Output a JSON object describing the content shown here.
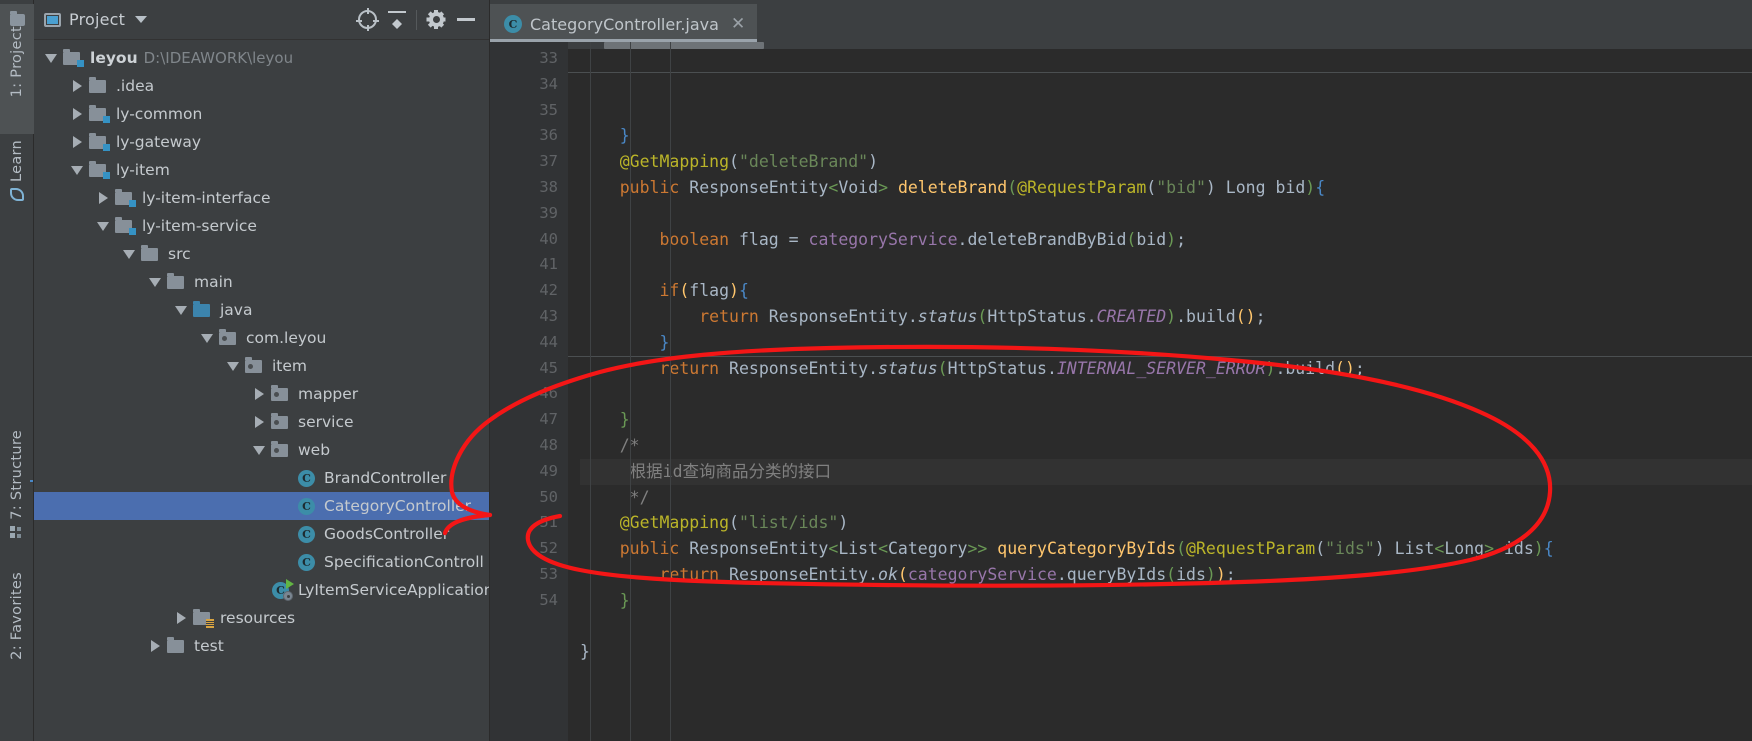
{
  "window": {
    "tool_tabs_left": [
      {
        "label": "1: Project",
        "icon": "project-folder-icon",
        "active": true
      },
      {
        "label": "Learn",
        "icon": "learn-icon",
        "active": false
      },
      {
        "label": "7: Structure",
        "icon": "structure-icon",
        "active": false
      },
      {
        "label": "2: Favorites",
        "icon": "favorites-icon",
        "active": false
      }
    ]
  },
  "project_panel": {
    "title": "Project",
    "dropdown_icon": "chevron-down-icon",
    "toolbar": [
      {
        "name": "locate-icon",
        "label": "Select Opened File"
      },
      {
        "name": "collapse-all-icon",
        "label": "Collapse All"
      },
      {
        "name": "gear-icon",
        "label": "Settings"
      },
      {
        "name": "minimize-icon",
        "label": "Hide"
      }
    ],
    "tree": [
      {
        "label": "leyou",
        "path": "D:\\IDEAWORK\\leyou",
        "depth": 0,
        "twisty": "down",
        "icon": "module-folder-icon",
        "bold": true,
        "selected": false
      },
      {
        "label": ".idea",
        "path": "",
        "depth": 1,
        "twisty": "right",
        "icon": "folder-icon",
        "bold": false,
        "selected": false
      },
      {
        "label": "ly-common",
        "path": "",
        "depth": 1,
        "twisty": "right",
        "icon": "module-folder-icon",
        "bold": false,
        "selected": false
      },
      {
        "label": "ly-gateway",
        "path": "",
        "depth": 1,
        "twisty": "right",
        "icon": "module-folder-icon",
        "bold": false,
        "selected": false
      },
      {
        "label": "ly-item",
        "path": "",
        "depth": 1,
        "twisty": "down",
        "icon": "module-folder-icon",
        "bold": false,
        "selected": false
      },
      {
        "label": "ly-item-interface",
        "path": "",
        "depth": 2,
        "twisty": "right",
        "icon": "module-folder-icon",
        "bold": false,
        "selected": false
      },
      {
        "label": "ly-item-service",
        "path": "",
        "depth": 2,
        "twisty": "down",
        "icon": "module-folder-icon",
        "bold": false,
        "selected": false
      },
      {
        "label": "src",
        "path": "",
        "depth": 3,
        "twisty": "down",
        "icon": "folder-icon",
        "bold": false,
        "selected": false
      },
      {
        "label": "main",
        "path": "",
        "depth": 4,
        "twisty": "down",
        "icon": "folder-icon",
        "bold": false,
        "selected": false
      },
      {
        "label": "java",
        "path": "",
        "depth": 5,
        "twisty": "down",
        "icon": "source-root-folder-icon",
        "bold": false,
        "selected": false
      },
      {
        "label": "com.leyou",
        "path": "",
        "depth": 6,
        "twisty": "down",
        "icon": "package-icon",
        "bold": false,
        "selected": false
      },
      {
        "label": "item",
        "path": "",
        "depth": 7,
        "twisty": "down",
        "icon": "package-icon",
        "bold": false,
        "selected": false
      },
      {
        "label": "mapper",
        "path": "",
        "depth": 8,
        "twisty": "right",
        "icon": "package-icon",
        "bold": false,
        "selected": false
      },
      {
        "label": "service",
        "path": "",
        "depth": 8,
        "twisty": "right",
        "icon": "package-icon",
        "bold": false,
        "selected": false
      },
      {
        "label": "web",
        "path": "",
        "depth": 8,
        "twisty": "down",
        "icon": "package-icon",
        "bold": false,
        "selected": false
      },
      {
        "label": "BrandController",
        "path": "",
        "depth": 9,
        "twisty": "none",
        "icon": "java-class-icon",
        "bold": false,
        "selected": false
      },
      {
        "label": "CategoryController",
        "path": "",
        "depth": 9,
        "twisty": "none",
        "icon": "java-class-icon",
        "bold": false,
        "selected": true
      },
      {
        "label": "GoodsController",
        "path": "",
        "depth": 9,
        "twisty": "none",
        "icon": "java-class-icon",
        "bold": false,
        "selected": false
      },
      {
        "label": "SpecificationControll",
        "path": "",
        "depth": 9,
        "twisty": "none",
        "icon": "java-class-icon",
        "bold": false,
        "selected": false
      },
      {
        "label": "LyItemServiceApplication",
        "path": "",
        "depth": 8,
        "twisty": "none",
        "icon": "spring-boot-main-class-icon",
        "bold": false,
        "selected": false
      },
      {
        "label": "resources",
        "path": "",
        "depth": 5,
        "twisty": "right",
        "icon": "resources-folder-icon",
        "bold": false,
        "selected": false
      },
      {
        "label": "test",
        "path": "",
        "depth": 4,
        "twisty": "right",
        "icon": "folder-icon",
        "bold": false,
        "selected": false
      }
    ]
  },
  "editor": {
    "tabs": [
      {
        "label": "CategoryController.java",
        "icon": "java-class-icon",
        "active": true,
        "close_icon": "close-icon"
      }
    ],
    "first_line_number": 33,
    "current_line_number": 46,
    "line_numbers": [
      33,
      34,
      35,
      36,
      37,
      38,
      39,
      40,
      41,
      42,
      43,
      44,
      45,
      46,
      47,
      48,
      49,
      50,
      51,
      52,
      53,
      54
    ],
    "lines": [
      {
        "n": 33,
        "tokens": [
          {
            "t": "    ",
            "c": "br1"
          },
          {
            "t": "}",
            "c": "brb"
          }
        ]
      },
      {
        "n": 34,
        "tokens": [
          {
            "t": "    ",
            "c": "br1"
          },
          {
            "t": "@GetMapping",
            "c": "ann"
          },
          {
            "t": "(",
            "c": "br1"
          },
          {
            "t": "\"deleteBrand\"",
            "c": "str"
          },
          {
            "t": ")",
            "c": "br1"
          }
        ]
      },
      {
        "n": 35,
        "tokens": [
          {
            "t": "    ",
            "c": "br1"
          },
          {
            "t": "public ",
            "c": "kw"
          },
          {
            "t": "ResponseEntity",
            "c": "ty"
          },
          {
            "t": "<",
            "c": "brg"
          },
          {
            "t": "Void",
            "c": "ty"
          },
          {
            "t": "> ",
            "c": "brg"
          },
          {
            "t": "deleteBrand",
            "c": "mth"
          },
          {
            "t": "(",
            "c": "brg"
          },
          {
            "t": "@RequestParam",
            "c": "ann"
          },
          {
            "t": "(",
            "c": "br1"
          },
          {
            "t": "\"bid\"",
            "c": "str"
          },
          {
            "t": ") ",
            "c": "br1"
          },
          {
            "t": "Long",
            "c": "ty"
          },
          {
            "t": " bid",
            "c": "br1"
          },
          {
            "t": ")",
            "c": "brg"
          },
          {
            "t": "{",
            "c": "brb"
          }
        ]
      },
      {
        "n": 36,
        "tokens": []
      },
      {
        "n": 37,
        "tokens": [
          {
            "t": "        ",
            "c": "br1"
          },
          {
            "t": "boolean",
            "c": "kw"
          },
          {
            "t": " flag ",
            "c": "br1"
          },
          {
            "t": "= ",
            "c": "br1"
          },
          {
            "t": "categoryService",
            "c": "fld"
          },
          {
            "t": ".deleteBrandByBid",
            "c": "br1"
          },
          {
            "t": "(",
            "c": "brg"
          },
          {
            "t": "bid",
            "c": "br1"
          },
          {
            "t": ")",
            "c": "brg"
          },
          {
            "t": ";",
            "c": "br1"
          }
        ]
      },
      {
        "n": 38,
        "tokens": []
      },
      {
        "n": 39,
        "tokens": [
          {
            "t": "        ",
            "c": "br1"
          },
          {
            "t": "if",
            "c": "kw"
          },
          {
            "t": "(",
            "c": "mth"
          },
          {
            "t": "flag",
            "c": "br1"
          },
          {
            "t": ")",
            "c": "mth"
          },
          {
            "t": "{",
            "c": "brb"
          }
        ]
      },
      {
        "n": 40,
        "tokens": [
          {
            "t": "            ",
            "c": "br1"
          },
          {
            "t": "return ",
            "c": "kw"
          },
          {
            "t": "ResponseEntity",
            "c": "ty"
          },
          {
            "t": ".",
            "c": "br1"
          },
          {
            "t": "status",
            "c": "stat"
          },
          {
            "t": "(",
            "c": "brg"
          },
          {
            "t": "HttpStatus",
            "c": "ty"
          },
          {
            "t": ".",
            "c": "br1"
          },
          {
            "t": "CREATED",
            "c": "fld stat"
          },
          {
            "t": ")",
            "c": "brg"
          },
          {
            "t": ".build",
            "c": "br1"
          },
          {
            "t": "(",
            "c": "mth"
          },
          {
            "t": ")",
            "c": "mth"
          },
          {
            "t": ";",
            "c": "br1"
          }
        ]
      },
      {
        "n": 41,
        "tokens": [
          {
            "t": "        ",
            "c": "br1"
          },
          {
            "t": "}",
            "c": "brb"
          }
        ]
      },
      {
        "n": 42,
        "tokens": [
          {
            "t": "        ",
            "c": "br1"
          },
          {
            "t": "return ",
            "c": "kw"
          },
          {
            "t": "ResponseEntity",
            "c": "ty"
          },
          {
            "t": ".",
            "c": "br1"
          },
          {
            "t": "status",
            "c": "stat"
          },
          {
            "t": "(",
            "c": "brg"
          },
          {
            "t": "HttpStatus",
            "c": "ty"
          },
          {
            "t": ".",
            "c": "br1"
          },
          {
            "t": "INTERNAL_SERVER_ERROR",
            "c": "fld stat"
          },
          {
            "t": ")",
            "c": "brg"
          },
          {
            "t": ".build",
            "c": "br1"
          },
          {
            "t": "(",
            "c": "mth"
          },
          {
            "t": ")",
            "c": "mth"
          },
          {
            "t": ";",
            "c": "br1"
          }
        ]
      },
      {
        "n": 43,
        "tokens": []
      },
      {
        "n": 44,
        "tokens": [
          {
            "t": "    ",
            "c": "br1"
          },
          {
            "t": "}",
            "c": "brg"
          }
        ]
      },
      {
        "n": 45,
        "tokens": [
          {
            "t": "    ",
            "c": "br1"
          },
          {
            "t": "/*",
            "c": "cmt"
          }
        ]
      },
      {
        "n": 46,
        "tokens": [
          {
            "t": "     ",
            "c": "br1"
          },
          {
            "t": "根据id查询商品分类的接口",
            "c": "cmt"
          }
        ]
      },
      {
        "n": 47,
        "tokens": [
          {
            "t": "     ",
            "c": "br1"
          },
          {
            "t": "*/",
            "c": "cmt"
          }
        ]
      },
      {
        "n": 48,
        "tokens": [
          {
            "t": "    ",
            "c": "br1"
          },
          {
            "t": "@GetMapping",
            "c": "ann"
          },
          {
            "t": "(",
            "c": "br1"
          },
          {
            "t": "\"list/ids\"",
            "c": "str"
          },
          {
            "t": ")",
            "c": "br1"
          }
        ]
      },
      {
        "n": 49,
        "tokens": [
          {
            "t": "    ",
            "c": "br1"
          },
          {
            "t": "public ",
            "c": "kw"
          },
          {
            "t": "ResponseEntity",
            "c": "ty"
          },
          {
            "t": "<",
            "c": "brg"
          },
          {
            "t": "List",
            "c": "ty"
          },
          {
            "t": "<",
            "c": "brg"
          },
          {
            "t": "Category",
            "c": "ty"
          },
          {
            "t": ">> ",
            "c": "brg"
          },
          {
            "t": "queryCategoryByIds",
            "c": "mth"
          },
          {
            "t": "(",
            "c": "brg"
          },
          {
            "t": "@RequestParam",
            "c": "ann"
          },
          {
            "t": "(",
            "c": "br1"
          },
          {
            "t": "\"ids\"",
            "c": "str"
          },
          {
            "t": ") ",
            "c": "br1"
          },
          {
            "t": "List",
            "c": "ty"
          },
          {
            "t": "<",
            "c": "brg"
          },
          {
            "t": "Long",
            "c": "ty"
          },
          {
            "t": "> ",
            "c": "brg"
          },
          {
            "t": "ids",
            "c": "br1"
          },
          {
            "t": ")",
            "c": "brg"
          },
          {
            "t": "{",
            "c": "brb"
          }
        ]
      },
      {
        "n": 50,
        "tokens": [
          {
            "t": "        ",
            "c": "br1"
          },
          {
            "t": "return ",
            "c": "kw"
          },
          {
            "t": "ResponseEntity",
            "c": "ty"
          },
          {
            "t": ".",
            "c": "br1"
          },
          {
            "t": "ok",
            "c": "stat"
          },
          {
            "t": "(",
            "c": "mth"
          },
          {
            "t": "categoryService",
            "c": "fld"
          },
          {
            "t": ".queryByIds",
            "c": "br1"
          },
          {
            "t": "(",
            "c": "brg"
          },
          {
            "t": "ids",
            "c": "br1"
          },
          {
            "t": ")",
            "c": "brg"
          },
          {
            "t": ")",
            "c": "mth"
          },
          {
            "t": ";",
            "c": "br1"
          }
        ]
      },
      {
        "n": 51,
        "tokens": [
          {
            "t": "    ",
            "c": "br1"
          },
          {
            "t": "}",
            "c": "brg"
          }
        ]
      },
      {
        "n": 52,
        "tokens": []
      },
      {
        "n": 53,
        "tokens": [
          {
            "t": "}",
            "c": "br1"
          }
        ]
      },
      {
        "n": 54,
        "tokens": []
      }
    ]
  },
  "annotation": {
    "type": "hand-drawn-red-lasso",
    "color": "#f41616",
    "description": "Red freehand circle around the queryCategoryByIds method block (lines 45-53)"
  },
  "colors": {
    "panel_bg": "#3c3f41",
    "editor_bg": "#2b2b2b",
    "gutter_bg": "#313335",
    "selection_blue": "#4b6eaf",
    "tab_active_bg": "#4e5254",
    "annotation_red": "#f41616",
    "keyword_orange": "#cc7832",
    "string_green": "#6a8759",
    "annotation_yellow": "#bbb529",
    "method_gold": "#ffc66d",
    "field_purple": "#9876aa",
    "comment_gray": "#808080",
    "text_default": "#a9b7c6"
  }
}
